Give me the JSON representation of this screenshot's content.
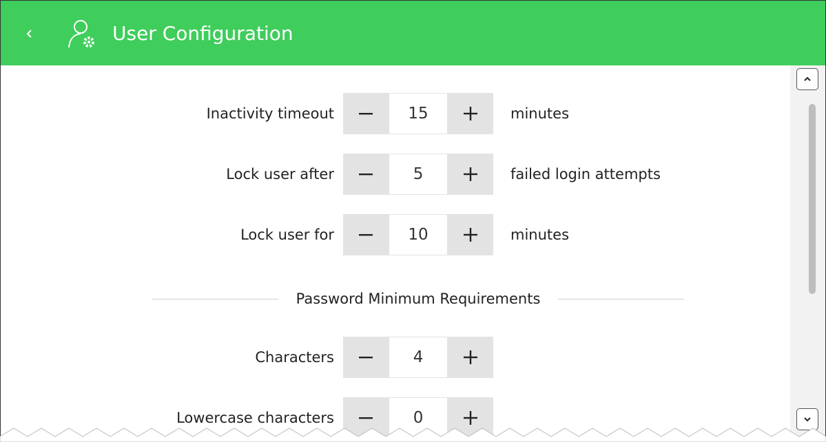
{
  "header": {
    "title": "User Configuration",
    "color": "#3fcd5b",
    "back_icon": "chevron-left-icon",
    "title_icon": "user-settings-icon"
  },
  "settings": [
    {
      "label": "Inactivity timeout",
      "value": "15",
      "unit": "minutes"
    },
    {
      "label": "Lock user after",
      "value": "5",
      "unit": "failed login attempts"
    },
    {
      "label": "Lock user for",
      "value": "10",
      "unit": "minutes"
    }
  ],
  "password_section": {
    "title": "Password Minimum Requirements",
    "items": [
      {
        "label": "Characters",
        "value": "4"
      },
      {
        "label": "Lowercase characters",
        "value": "0"
      }
    ]
  },
  "stepper": {
    "decrement_icon": "minus-icon",
    "increment_icon": "plus-icon"
  },
  "scrollbar": {
    "up_icon": "chevron-up-icon",
    "down_icon": "chevron-down-icon"
  }
}
